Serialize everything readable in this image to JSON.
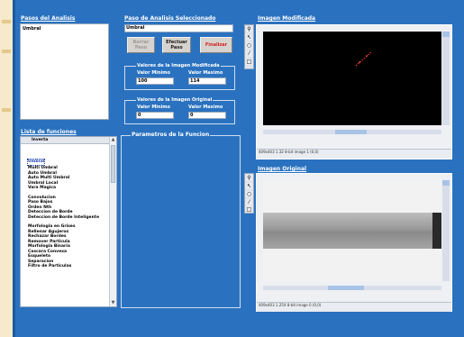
{
  "left_strip": {
    "background": "#f6e9cc"
  },
  "pasos": {
    "title": "Pasos del Analisis",
    "items": [
      "Umbral"
    ]
  },
  "seleccionado": {
    "title": "Paso de Analisis Seleccionado",
    "value": "Umbral",
    "borrar_label": "Borrar Paso",
    "efectuar_label": "Efectuar Paso",
    "finalizar_label": "Finalizar"
  },
  "modificada_values": {
    "title": "Valores de la Imagen Modificada",
    "min_label": "Valor Minimo",
    "max_label": "Valor Maximo",
    "min_value": "100",
    "max_value": "114"
  },
  "original_values": {
    "title": "Valores de la Imagen Original",
    "min_label": "Valor Minimo",
    "max_label": "Valor Maximo",
    "min_value": "0",
    "max_value": "0"
  },
  "funciones": {
    "title": "Lista de funciones",
    "header": "Inverta",
    "groups": [
      [
        "Umbral",
        "Multi Umbral",
        "Auto Umbral",
        "Auto Multi Umbral",
        "Umbral Local",
        "Vara Magica"
      ],
      [
        "Convolucion",
        "Paso Bajos",
        "Orden Nth",
        "Deteccion de Borde",
        "Deteccion de Borde Inteligente"
      ],
      [
        "Morfologia en Grises",
        "Rellenar Agujeros",
        "Rechazar Bordes",
        "Remover Particula",
        "Morfologia Binaria",
        "Cascara Convexa",
        "Esqueleto",
        "Separacion",
        "Filtro de Particulas"
      ]
    ],
    "selected": "Umbral"
  },
  "parametros": {
    "title": "Parametros de la Funcion"
  },
  "imagen_modificada": {
    "title": "Imagen Modificada",
    "status": "409x403 1.32 8-bit image 1   (0,0)"
  },
  "imagen_original": {
    "title": "Imagen Original",
    "status": "409x403 1.25X 8-bit image 0   (0,0)"
  },
  "tool_icons": [
    "zoom-icon",
    "pointer-icon",
    "pan-icon",
    "line-icon",
    "rectangle-icon"
  ],
  "colors": {
    "background": "#2a72c0",
    "panel_border": "#d0dcef",
    "finalizar_text": "#d02020"
  }
}
